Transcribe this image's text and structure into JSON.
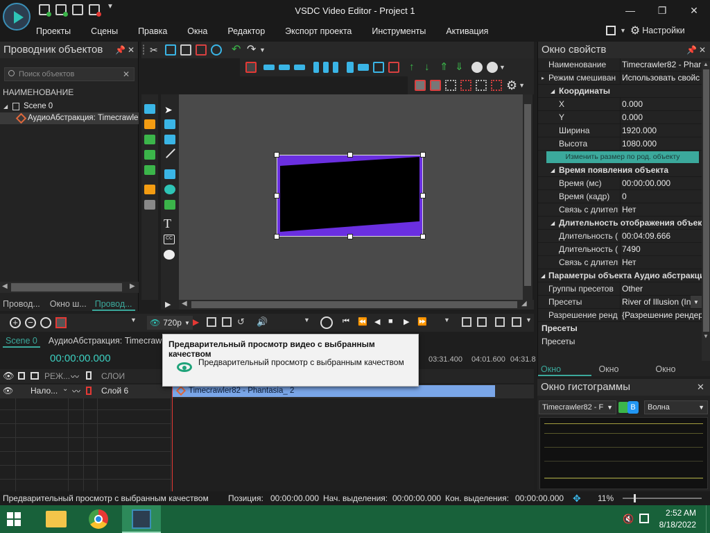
{
  "window": {
    "title": "VSDC Video Editor - Project 1",
    "minimize": "—",
    "maximize": "❐",
    "close": "✕"
  },
  "menu": [
    "Проекты",
    "Сцены",
    "Правка",
    "Окна",
    "Редактор",
    "Экспорт проекта",
    "Инструменты",
    "Активация"
  ],
  "settings_label": "Настройки",
  "object_explorer": {
    "title": "Проводник объектов",
    "search_placeholder": "Поиск объектов",
    "column_header": "НАИМЕНОВАНИЕ",
    "tree": [
      {
        "label": "Scene 0"
      },
      {
        "label": "АудиоАбстракция: Timecrawler"
      }
    ],
    "tabs": [
      "Провод...",
      "Окно ш...",
      "Провод..."
    ]
  },
  "properties": {
    "title": "Окно свойств",
    "rows": [
      {
        "k": "Наименование",
        "v": "Timecrawler82 - Phar",
        "type": "top"
      },
      {
        "k": "Режим смешиван",
        "v": "Использовать свойс",
        "type": "top"
      },
      {
        "k": "Координаты",
        "v": "",
        "type": "sec"
      },
      {
        "k": "X",
        "v": "0.000",
        "type": "row"
      },
      {
        "k": "Y",
        "v": "0.000",
        "type": "row"
      },
      {
        "k": "Ширина",
        "v": "1920.000",
        "type": "row"
      },
      {
        "k": "Высота",
        "v": "1080.000",
        "type": "row"
      },
      {
        "k": "",
        "v": "",
        "type": "btn"
      },
      {
        "k": "Время появления объекта",
        "v": "",
        "type": "sec"
      },
      {
        "k": "Время (мс)",
        "v": "00:00:00.000",
        "type": "row"
      },
      {
        "k": "Время (кадр)",
        "v": "0",
        "type": "row"
      },
      {
        "k": "Связь с длитель",
        "v": "Нет",
        "type": "row"
      },
      {
        "k": "Длительность отображения объек",
        "v": "",
        "type": "sec"
      },
      {
        "k": "Длительность (",
        "v": "00:04:09.666",
        "type": "row"
      },
      {
        "k": "Длительность (",
        "v": "7490",
        "type": "row"
      },
      {
        "k": "Связь с длитель",
        "v": "Нет",
        "type": "row"
      },
      {
        "k": "Параметры объекта Аудио абстракци",
        "v": "",
        "type": "sec2"
      },
      {
        "k": "Группы пресетов",
        "v": "Other",
        "type": "top"
      },
      {
        "k": "Пресеты",
        "v": "River of Illusion (In",
        "type": "top"
      },
      {
        "k": "Разрешение ренд",
        "v": "{Разрешение рендер",
        "type": "top"
      }
    ],
    "resize_button": "Изменить размер по род. объекту",
    "desc_title": "Пресеты",
    "desc_text": "Пресеты",
    "tabs": [
      "Окно свой...",
      "Окно ресу...",
      "Окно базов..."
    ]
  },
  "histogram": {
    "title": "Окно гистограммы",
    "source": "Timecrawler82 - F",
    "mode": "Волна",
    "channel": "B"
  },
  "timeline": {
    "quality": "720p",
    "tabs": [
      "Scene 0",
      "АудиоАбстракция: Timecrawler"
    ],
    "timecode": "00:00:00.000",
    "ruler": [
      "03:31.400",
      "04:01.600",
      "04:31.8"
    ],
    "header_labels": [
      "РЕЖ...",
      "СЛОИ"
    ],
    "track": {
      "blend": "Нало...",
      "layer": "Слой 6"
    },
    "clip_label": "Timecrawler82 - Phantasia_ 2"
  },
  "tooltip": {
    "title": "Предварительный просмотр видео с выбранным качеством",
    "body": "Предварительный просмотр с выбранным качеством"
  },
  "status": {
    "message": "Предварительный просмотр с выбранным качеством",
    "position_label": "Позиция:",
    "position_value": "00:00:00.000",
    "sel_start_label": "Нач. выделения:",
    "sel_start_value": "00:00:00.000",
    "sel_end_label": "Кон. выделения:",
    "sel_end_value": "00:00:00.000",
    "zoom": "11%"
  },
  "taskbar": {
    "time": "2:52 AM",
    "date": "8/18/2022"
  },
  "colors": {
    "accent": "#3ba99c",
    "clip": "#7aa6e8",
    "playhead": "#e53935",
    "taskbar": "#18613a"
  }
}
